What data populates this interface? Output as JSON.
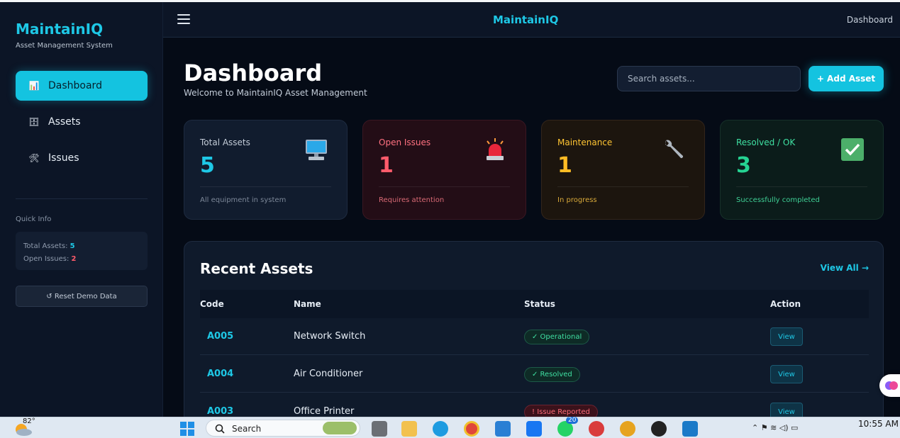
{
  "sidebar": {
    "brand": "MaintainIQ",
    "subtitle": "Asset Management System",
    "items": [
      {
        "label": "Dashboard",
        "icon": "📊"
      },
      {
        "label": "Assets",
        "icon": "🗄"
      },
      {
        "label": "Issues",
        "icon": "🛠"
      }
    ],
    "quick_info_title": "Quick Info",
    "quick_info": {
      "total_label": "Total Assets:",
      "total_value": "5",
      "open_label": "Open Issues:",
      "open_value": "2"
    },
    "reset_label": "↺ Reset Demo Data"
  },
  "topnav": {
    "brand": "MaintainIQ",
    "breadcrumb": "Dashboard"
  },
  "header": {
    "title": "Dashboard",
    "subtitle": "Welcome to MaintainIQ Asset Management",
    "search_placeholder": "Search assets...",
    "add_label": "+ Add Asset"
  },
  "stats": [
    {
      "label": "Total Assets",
      "value": "5",
      "foot": "All equipment in system",
      "icon": "monitor-icon"
    },
    {
      "label": "Open Issues",
      "value": "1",
      "foot": "Requires attention",
      "icon": "alarm-light-icon"
    },
    {
      "label": "Maintenance",
      "value": "1",
      "foot": "In progress",
      "icon": "wrench-icon"
    },
    {
      "label": "Resolved / OK",
      "value": "3",
      "foot": "Successfully completed",
      "icon": "checkmark-icon"
    }
  ],
  "recent": {
    "title": "Recent Assets",
    "view_all": "View All →",
    "columns": [
      "Code",
      "Name",
      "Status",
      "Action"
    ],
    "rows": [
      {
        "code": "A005",
        "name": "Network Switch",
        "status": "✓ Operational",
        "action": "View"
      },
      {
        "code": "A004",
        "name": "Air Conditioner",
        "status": "✓ Resolved",
        "action": "View"
      },
      {
        "code": "A003",
        "name": "Office Printer",
        "status": "! Issue Reported",
        "action": "View"
      }
    ]
  },
  "taskbar": {
    "temperature": "82°",
    "search_label": "Search",
    "badge_count": "20",
    "time": "10:55 AM"
  },
  "colors": {
    "accent": "#14c3e0",
    "danger": "#ff5b6b",
    "warning": "#ffbc24",
    "success": "#25d392"
  }
}
